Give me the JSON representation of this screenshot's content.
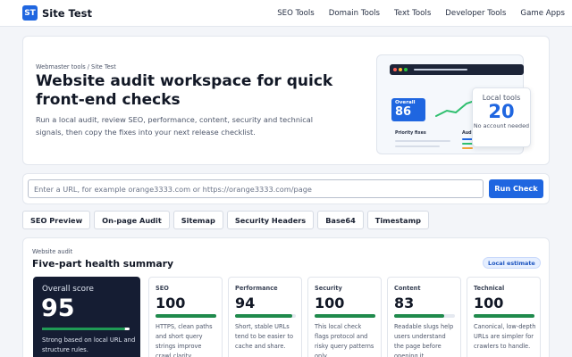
{
  "brand": {
    "logo_text": "ST",
    "name": "Site Test",
    "accent": "#1f66e0"
  },
  "nav": [
    "SEO Tools",
    "Domain Tools",
    "Text Tools",
    "Developer Tools",
    "Game Apps"
  ],
  "hero": {
    "breadcrumb": "Webmaster tools / Site Test",
    "title": "Website audit workspace for quick front-end checks",
    "description": "Run a local audit, review SEO, performance, content, security and technical signals, then copy the fixes into your next release checklist.",
    "preview": {
      "overall_label": "Overall",
      "overall_value": "86",
      "priority_label": "Priority fixes",
      "audit_label": "Aud"
    },
    "local_tools": {
      "label": "Local tools",
      "value": "20",
      "sub": "No account needed"
    }
  },
  "url_bar": {
    "placeholder": "Enter a URL, for example orange3333.com or https://orange3333.com/page",
    "button": "Run Check"
  },
  "tabs": [
    "SEO Preview",
    "On-page Audit",
    "Sitemap",
    "Security Headers",
    "Base64",
    "Timestamp"
  ],
  "summary": {
    "eyebrow": "Website audit",
    "title": "Five-part health summary",
    "badge": "Local estimate",
    "overall": {
      "label": "Overall score",
      "value": "95",
      "progress": 0.95,
      "note": "Strong based on local URL and structure rules."
    },
    "metrics": [
      {
        "label": "SEO",
        "value": "100",
        "progress": 1.0,
        "desc": "HTTPS, clean paths and short query strings improve crawl clarity."
      },
      {
        "label": "Performance",
        "value": "94",
        "progress": 0.94,
        "desc": "Short, stable URLs tend to be easier to cache and share."
      },
      {
        "label": "Security",
        "value": "100",
        "progress": 1.0,
        "desc": "This local check flags protocol and risky query patterns only."
      },
      {
        "label": "Content",
        "value": "83",
        "progress": 0.83,
        "desc": "Readable slugs help users understand the page before opening it."
      },
      {
        "label": "Technical",
        "value": "100",
        "progress": 1.0,
        "desc": "Canonical, low-depth URLs are simpler for crawlers to handle."
      }
    ]
  }
}
